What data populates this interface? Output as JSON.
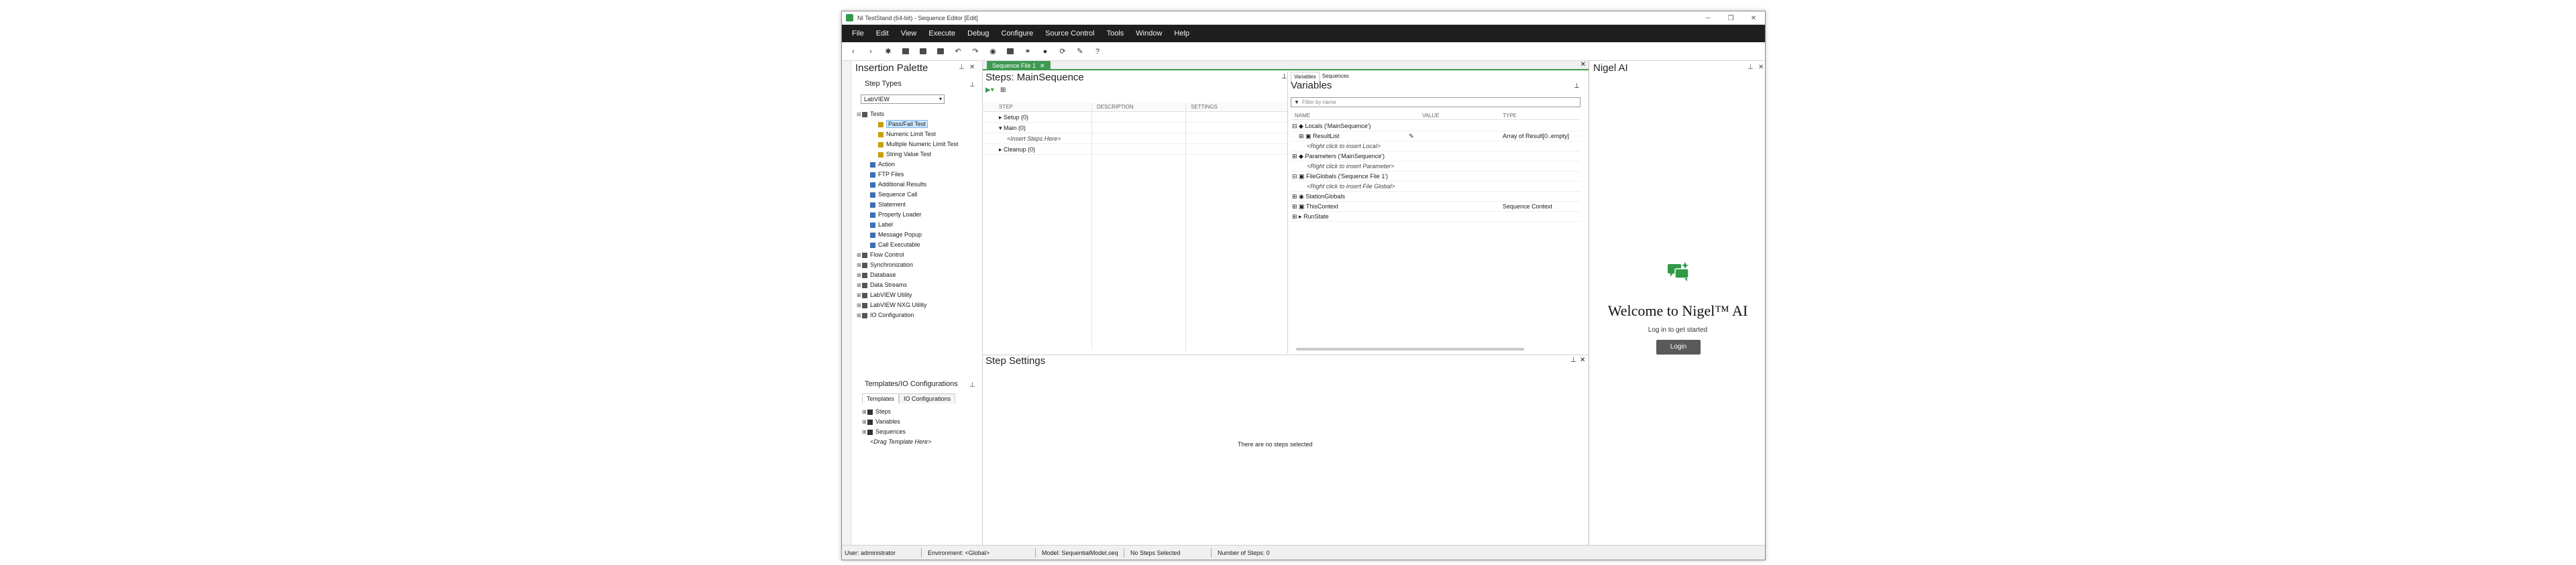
{
  "window": {
    "title": "NI TestStand (64-bit) - Sequence Editor [Edit]"
  },
  "window_controls": {
    "minimize": "─",
    "restore": "❐",
    "close": "✕"
  },
  "menu": [
    "File",
    "Edit",
    "View",
    "Execute",
    "Debug",
    "Configure",
    "Source Control",
    "Tools",
    "Window",
    "Help"
  ],
  "palette": {
    "title": "Insertion Palette",
    "step_types_title": "Step Types",
    "adapter": "LabVIEW",
    "tree": [
      {
        "label": "Tests",
        "indent": 0,
        "exp": "⊟"
      },
      {
        "label": "Pass/Fail Test",
        "indent": 2,
        "selected": true
      },
      {
        "label": "Numeric Limit Test",
        "indent": 2
      },
      {
        "label": "Multiple Numeric Limit Test",
        "indent": 2
      },
      {
        "label": "String Value Test",
        "indent": 2
      },
      {
        "label": "Action",
        "indent": 1
      },
      {
        "label": "FTP Files",
        "indent": 1
      },
      {
        "label": "Additional Results",
        "indent": 1
      },
      {
        "label": "Sequence Call",
        "indent": 1
      },
      {
        "label": "Statement",
        "indent": 1
      },
      {
        "label": "Property Loader",
        "indent": 1
      },
      {
        "label": "Label",
        "indent": 1
      },
      {
        "label": "Message Popup",
        "indent": 1
      },
      {
        "label": "Call Executable",
        "indent": 1
      },
      {
        "label": "Flow Control",
        "indent": 0,
        "exp": "⊞"
      },
      {
        "label": "Synchronization",
        "indent": 0,
        "exp": "⊞"
      },
      {
        "label": "Database",
        "indent": 0,
        "exp": "⊞"
      },
      {
        "label": "Data Streams",
        "indent": 0,
        "exp": "⊞"
      },
      {
        "label": "LabVIEW Utility",
        "indent": 0,
        "exp": "⊞"
      },
      {
        "label": "LabVIEW NXG Utility",
        "indent": 0,
        "exp": "⊞"
      },
      {
        "label": "IO Configuration",
        "indent": 0,
        "exp": "⊞"
      }
    ],
    "templates_title": "Templates/IO Configurations",
    "templates_tabs": [
      "Templates",
      "IO Configurations"
    ],
    "templates_tree": [
      "Steps",
      "Variables",
      "Sequences"
    ],
    "drag_hint": "<Drag Template Here>"
  },
  "document": {
    "tab": "Sequence File 1"
  },
  "steps": {
    "title": "Steps: MainSequence",
    "columns": [
      "STEP",
      "DESCRIPTION",
      "SETTINGS"
    ],
    "rows": [
      "Setup (0)",
      "Main (0)",
      "<Insert Steps Here>",
      "Cleanup (0)"
    ]
  },
  "variables": {
    "tabs": [
      "Variables",
      "Sequences"
    ],
    "title": "Variables",
    "filter_placeholder": "Filter by name",
    "columns": [
      "NAME",
      "VALUE",
      "TYPE"
    ],
    "rows": [
      {
        "name": "Locals ('MainSequence')",
        "type": ""
      },
      {
        "name": "ResultList",
        "type": "Array of Result[0..empty]"
      },
      {
        "name": "<Right click to insert Local>",
        "type": ""
      },
      {
        "name": "Parameters ('MainSequence')",
        "type": ""
      },
      {
        "name": "<Right click to insert Parameter>",
        "type": ""
      },
      {
        "name": "FileGlobals ('Sequence File 1')",
        "type": ""
      },
      {
        "name": "<Right click to insert File Global>",
        "type": ""
      },
      {
        "name": "StationGlobals",
        "type": ""
      },
      {
        "name": "ThisContext",
        "type": "Sequence Context"
      },
      {
        "name": "RunState",
        "type": ""
      }
    ]
  },
  "settings": {
    "title": "Step Settings",
    "empty": "There are no steps selected"
  },
  "ai": {
    "title": "Nigel AI",
    "welcome": "Welcome to Nigel™ AI",
    "subtitle": "Log in to get started",
    "login": "Login"
  },
  "status": {
    "user": "User: administrator",
    "environment": "Environment: <Global>",
    "model": "Model: SequentialModel.seq",
    "selected": "No Steps Selected",
    "count": "Number of Steps: 0"
  },
  "colors": {
    "accent": "#3f9a52",
    "menubar": "#1e1e1e"
  }
}
